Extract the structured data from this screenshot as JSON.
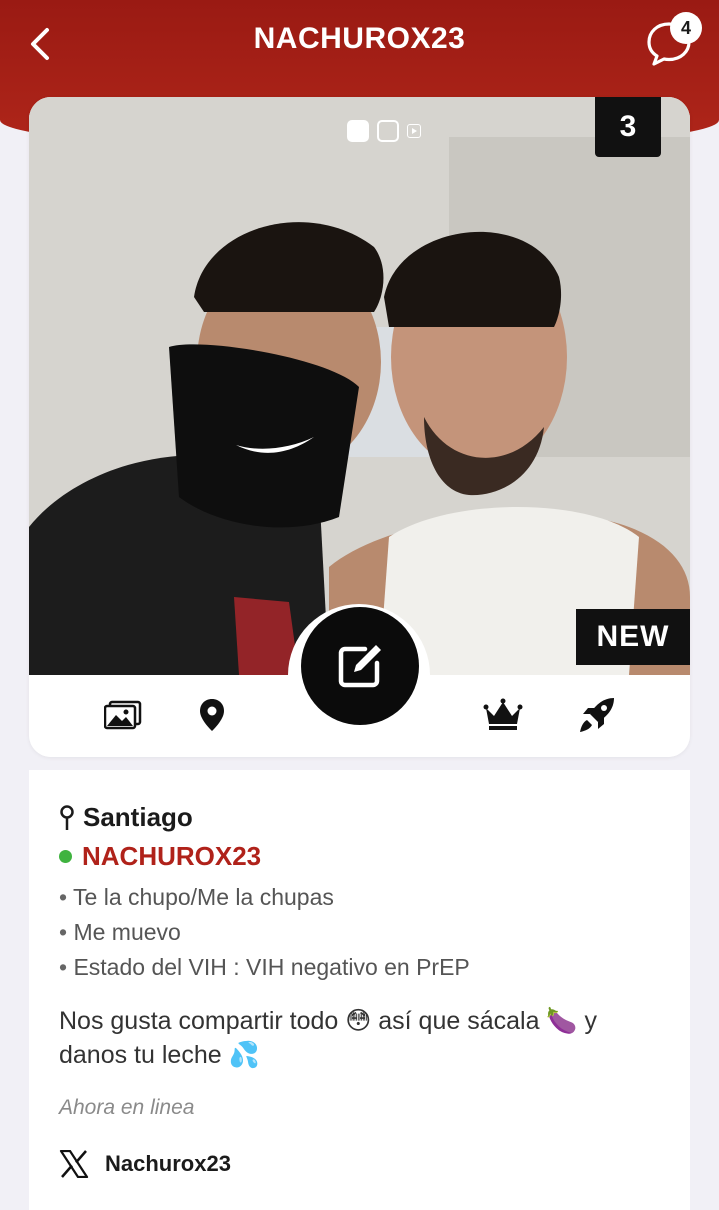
{
  "header": {
    "title": "NACHUROX23",
    "back_icon": "chevron-left-icon",
    "chat_icon": "chat-bubble-icon",
    "chat_badge": "4",
    "background": "#a81f16"
  },
  "photo": {
    "count": "3",
    "badge": "NEW",
    "indicators": [
      "photo",
      "photo",
      "video"
    ],
    "active_index": 0,
    "description_alt": "profile photo"
  },
  "actions": {
    "left": [
      "gallery-icon",
      "location-pin-icon"
    ],
    "center": "edit-icon",
    "right": [
      "crown-icon",
      "rocket-icon"
    ]
  },
  "profile": {
    "location": "Santiago",
    "username": "NACHUROX23",
    "online_color": "#3fb33f",
    "username_color": "#b0221a",
    "details": [
      "Te la chupo/Me la chupas",
      "Me muevo",
      "Estado del VIH : VIH negativo en PrEP"
    ],
    "bio_line1": "Nos gusta compartir todo 😳 así que sácala 🍆 y",
    "bio_line2": "danos tu leche 💦",
    "status": "Ahora en linea",
    "social_handle": "Nachurox23"
  }
}
